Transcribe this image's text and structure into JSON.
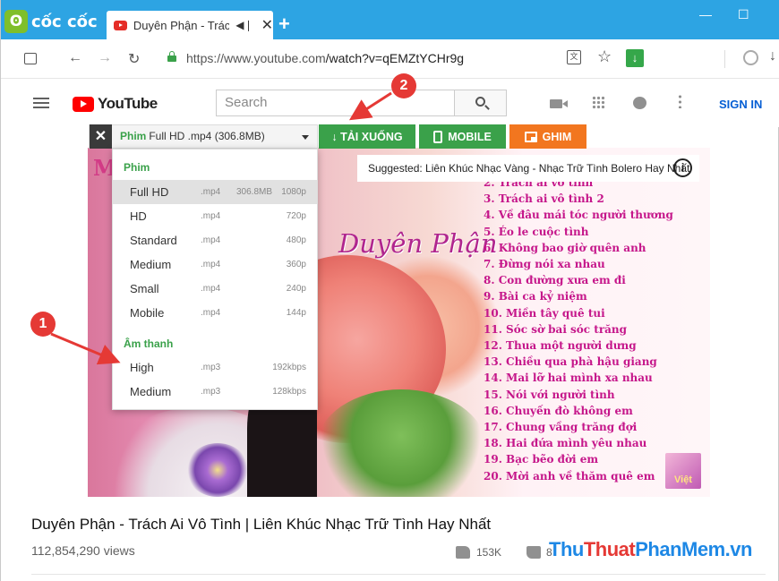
{
  "browser": {
    "brand": "cốc cốc",
    "tab_title": "Duyên Phận - Trác",
    "url_host": "https://www.youtube.com",
    "url_path": "/watch?v=qEMZtYCHr9g",
    "new_tab_glyph": "+",
    "minimize_glyph": "—",
    "maximize_glyph": "☐",
    "icons": [
      "page-info-icon",
      "back-icon",
      "forward-icon",
      "reload-icon",
      "lock-icon",
      "translate-icon",
      "star-icon",
      "download-icon",
      "profile-icon"
    ]
  },
  "youtube": {
    "logo_text": "YouTube",
    "search_placeholder": "Search",
    "signin_label": "SIGN IN"
  },
  "downloader": {
    "close_glyph": "✕",
    "selected_category": "Phim",
    "selected_format": "Full HD .mp4 (306.8MB)",
    "download_label": "↓ TẢI XUỐNG",
    "mobile_label": "MOBILE",
    "pin_label": "GHIM",
    "sections": [
      {
        "heading": "Phim",
        "items": [
          {
            "quality": "Full HD",
            "ext": ".mp4",
            "size": "306.8MB",
            "res": "1080p",
            "selected": true
          },
          {
            "quality": "HD",
            "ext": ".mp4",
            "size": "",
            "res": "720p"
          },
          {
            "quality": "Standard",
            "ext": ".mp4",
            "size": "",
            "res": "480p"
          },
          {
            "quality": "Medium",
            "ext": ".mp4",
            "size": "",
            "res": "360p"
          },
          {
            "quality": "Small",
            "ext": ".mp4",
            "size": "",
            "res": "240p"
          },
          {
            "quality": "Mobile",
            "ext": ".mp4",
            "size": "",
            "res": "144p"
          }
        ]
      },
      {
        "heading": "Âm thanh",
        "items": [
          {
            "quality": "High",
            "ext": ".mp3",
            "size": "",
            "res": "192kbps"
          },
          {
            "quality": "Medium",
            "ext": ".mp3",
            "size": "",
            "res": "128kbps"
          }
        ]
      }
    ]
  },
  "video": {
    "corner_tag": "M",
    "art_title": "Duyên Phận",
    "suggested": "Suggested: Liên Khúc Nhạc Vàng - Nhạc Trữ Tình Bolero Hay Nhất",
    "info_glyph": "i",
    "badge": "Việt",
    "songs": [
      "2. Trách ai vô tình",
      "3. Trách ai vô tình 2",
      "4. Về đâu mái tóc người thương",
      "5. Éo le cuộc tình",
      "6. Không bao giờ quên anh",
      "7. Đừng nói xa nhau",
      "8. Con đường xưa em đi",
      "9. Bài ca kỷ niệm",
      "10. Miền tây quê tui",
      "11. Sóc sờ bai sóc trăng",
      "12. Thua một người dưng",
      "13. Chiều qua phà hậu giang",
      "14. Mai lỡ hai mình xa nhau",
      "15. Nói với người tình",
      "16. Chuyến đò không em",
      "17. Chung vầng trăng đợi",
      "18. Hai đứa mình yêu nhau",
      "19. Bạc bẽo đời em",
      "20. Mời anh về thăm quê em"
    ],
    "title": "Duyên Phận - Trách Ai Vô Tình | Liên Khúc Nhạc Trữ Tình Hay Nhất",
    "views": "112,854,290 views",
    "likes": "153K",
    "dislikes": "8"
  },
  "annotations": {
    "marker_1": "1",
    "marker_2": "2",
    "color": "#e53935"
  },
  "watermark": {
    "part1": "Thu",
    "part2": "Thuat",
    "part3": "PhanMem.vn"
  }
}
